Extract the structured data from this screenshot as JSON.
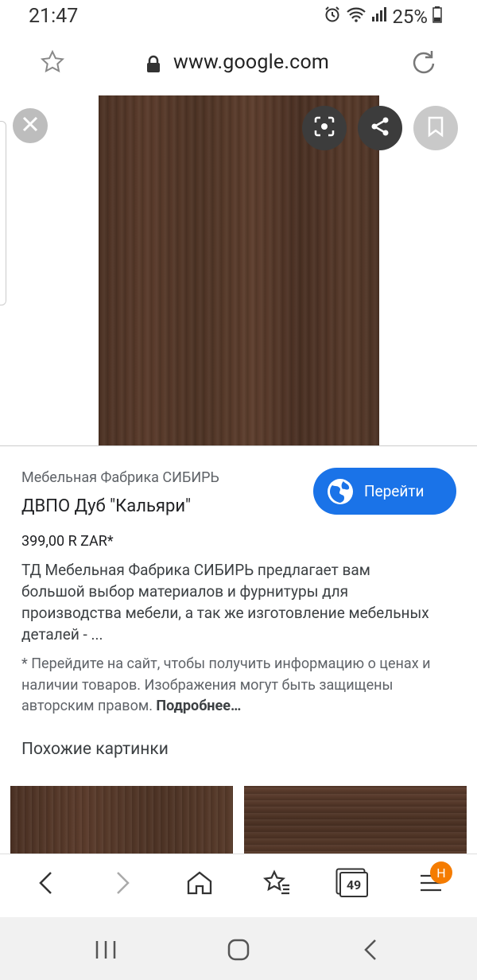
{
  "status": {
    "time": "21:47",
    "battery": "25%"
  },
  "browser": {
    "url": "www.google.com"
  },
  "result": {
    "source": "Мебельная Фабрика СИБИРЬ",
    "title": "ДВПО Дуб \"Кальяри\"",
    "price": "399,00 R ZAR*",
    "description": "ТД Мебельная Фабрика СИБИРЬ предлагает вам большой выбор материалов и фурнитуры для производства мебели, а так же изготовление мебельных деталей - ...",
    "note": "* Перейдите на сайт, чтобы получить информацию о ценах и наличии товаров. Изображения могут быть защищены авторским правом.",
    "more_link": "Подробнее…",
    "go_button": "Перейти"
  },
  "similar": {
    "title": "Похожие картинки"
  },
  "nav": {
    "tabs_count": "49",
    "badge": "H"
  },
  "colors": {
    "accent": "#1a73e8",
    "badge": "#f57c00",
    "wood": "#4f3426"
  }
}
